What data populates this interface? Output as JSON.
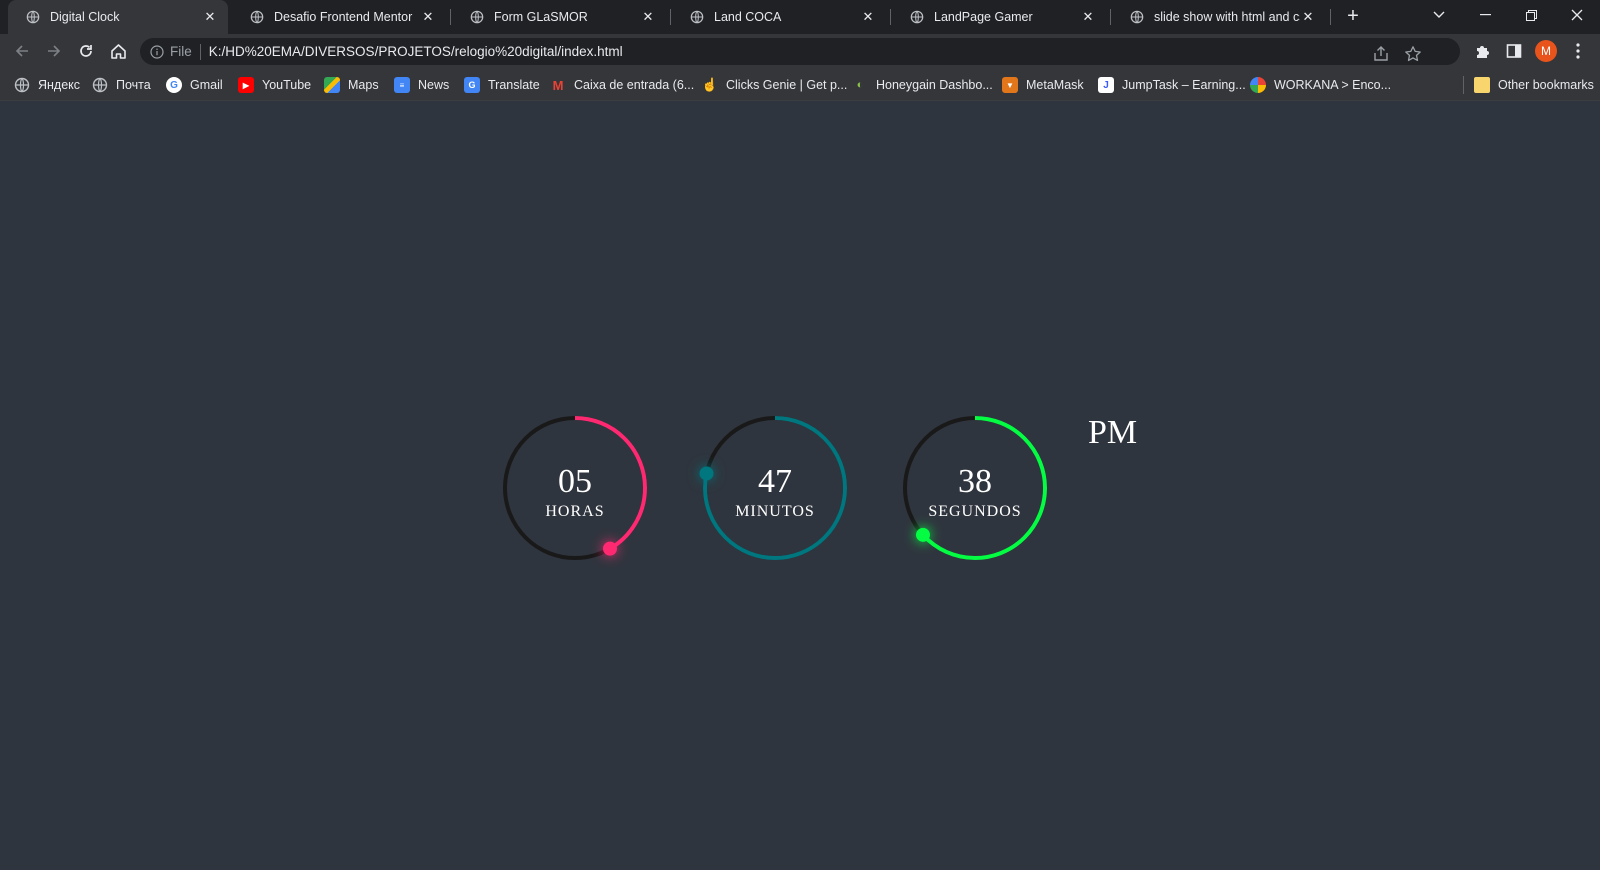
{
  "tabs": [
    {
      "title": "Digital Clock",
      "active": true
    },
    {
      "title": "Desafio Frontend Mentor",
      "active": false
    },
    {
      "title": "Form GLaSMOR",
      "active": false
    },
    {
      "title": "Land COCA",
      "active": false
    },
    {
      "title": "LandPage Gamer",
      "active": false
    },
    {
      "title": "slide show with html and css",
      "active": false
    }
  ],
  "address_bar": {
    "scheme": "File",
    "url": "K:/HD%20EMA/DIVERSOS/PROJETOS/relogio%20digital/index.html"
  },
  "profile": {
    "initial": "M",
    "color": "#e8541b"
  },
  "bookmarks": [
    {
      "label": "Яндекс",
      "icon": "globe-icon"
    },
    {
      "label": "Почта",
      "icon": "globe-icon"
    },
    {
      "label": "Gmail",
      "icon": "google-icon"
    },
    {
      "label": "YouTube",
      "icon": "youtube-icon"
    },
    {
      "label": "Maps",
      "icon": "maps-icon"
    },
    {
      "label": "News",
      "icon": "news-icon"
    },
    {
      "label": "Translate",
      "icon": "translate-icon"
    },
    {
      "label": "Caixa de entrada (6...",
      "icon": "gmail-icon"
    },
    {
      "label": "Clicks Genie | Get p...",
      "icon": "hand-icon"
    },
    {
      "label": "Honeygain Dashbo...",
      "icon": "honeygain-icon"
    },
    {
      "label": "MetaMask",
      "icon": "fox-icon"
    },
    {
      "label": "JumpTask – Earning...",
      "icon": "jumptask-icon"
    },
    {
      "label": "WORKANA > Enco...",
      "icon": "workana-icon"
    }
  ],
  "other_bookmarks": "Other bookmarks",
  "clock": {
    "hours": {
      "value": "05",
      "label": "HORAS",
      "color": "#ff2972",
      "progress": 0.4167
    },
    "minutes": {
      "value": "47",
      "label": "MINUTOS",
      "color": "#00767f",
      "progress": 0.7833
    },
    "seconds": {
      "value": "38",
      "label": "SEGUNDOS",
      "color": "#04fc43",
      "progress": 0.6333
    },
    "ampm": "PM",
    "track_color": "#191919"
  }
}
